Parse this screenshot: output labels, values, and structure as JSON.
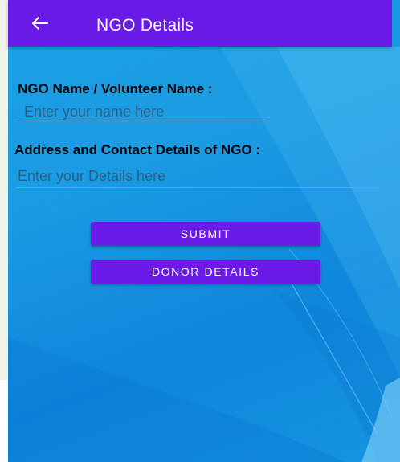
{
  "app_bar": {
    "title": "NGO Details",
    "back_icon": "arrow-left-icon",
    "color": "#6a1be8"
  },
  "form": {
    "name_label": "NGO Name / Volunteer Name :",
    "name_placeholder": "Enter your name here",
    "name_value": "",
    "address_label": "Address and Contact Details of NGO :",
    "address_placeholder": "Enter your Details here",
    "address_value": ""
  },
  "buttons": {
    "submit_label": "SUBMIT",
    "donor_details_label": "DONOR DETAILS",
    "color": "#6a1be8"
  },
  "colors": {
    "background": "#1b9be3",
    "accent": "#6a1be8"
  }
}
